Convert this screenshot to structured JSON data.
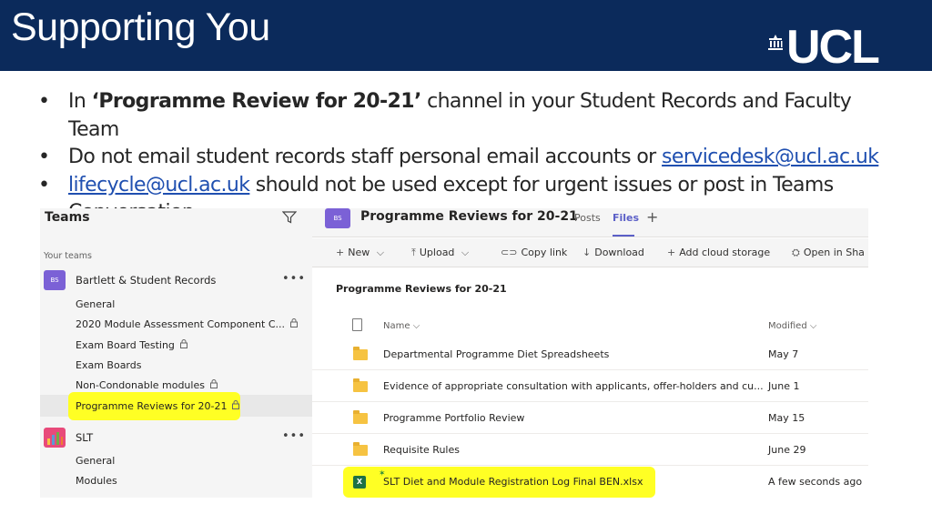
{
  "slide": {
    "title": "Supporting You",
    "logo_text": "UCL"
  },
  "bullets": {
    "b1_prefix": "In ",
    "b1_bold": "‘Programme Review for 20-21’",
    "b1_rest": " channel in your Student Records and Faculty Team",
    "b2_text": "Do not email student records staff personal email accounts or ",
    "b2_link": "servicedesk@ucl.ac.uk",
    "b3_link": "lifecycle@ucl.ac.uk",
    "b3_rest": " should not be used except for urgent issues or post in Teams Conversation",
    "bullet_glyph": "•"
  },
  "teams": {
    "left_title": "Teams",
    "your_teams": "Your teams",
    "team1": {
      "avatar": "BS",
      "name": "Bartlett & Student Records",
      "more": "•••",
      "color": "#7b61d6"
    },
    "team1_channels": [
      {
        "label": "General",
        "locked": false
      },
      {
        "label": "2020 Module Assessment Component C...",
        "locked": true
      },
      {
        "label": "Exam Board Testing",
        "locked": true
      },
      {
        "label": "Exam Boards",
        "locked": false
      },
      {
        "label": "Non-Condonable modules",
        "locked": true
      },
      {
        "label": "Programme Reviews for 20-21",
        "locked": true
      }
    ],
    "team2": {
      "name": "SLT",
      "more": "•••"
    },
    "team2_channels": [
      {
        "label": "General"
      },
      {
        "label": "Modules"
      }
    ],
    "lock_glyph": "🔒"
  },
  "channel": {
    "avatar": "BS",
    "title": "Programme Reviews for 20-21",
    "tabs": {
      "posts": "Posts",
      "files": "Files",
      "add": "+"
    },
    "commands": {
      "new": "New",
      "upload": "Upload",
      "copy_link": "Copy link",
      "download": "Download",
      "add_cloud": "Add cloud storage",
      "open_in": "Open in Sha"
    },
    "path": "Programme Reviews for 20-21",
    "columns": {
      "name": "Name",
      "modified": "Modified"
    },
    "files": [
      {
        "name": "Departmental Programme Diet Spreadsheets",
        "modified": "May 7",
        "type": "folder"
      },
      {
        "name": "Evidence of appropriate consultation with applicants, offer-holders and cu...",
        "modified": "June 1",
        "type": "folder"
      },
      {
        "name": "Programme Portfolio Review",
        "modified": "May 15",
        "type": "folder"
      },
      {
        "name": "Requisite Rules",
        "modified": "June 29",
        "type": "folder"
      },
      {
        "name": "SLT Diet and Module Registration Log Final BEN.xlsx",
        "modified": "A few seconds ago",
        "type": "excel",
        "highlighted": true
      }
    ]
  },
  "colors": {
    "header_bg": "#0b2a5b",
    "highlight": "#ffff24",
    "teams_purple": "#5b5fc7",
    "link": "#1f4fb0"
  }
}
